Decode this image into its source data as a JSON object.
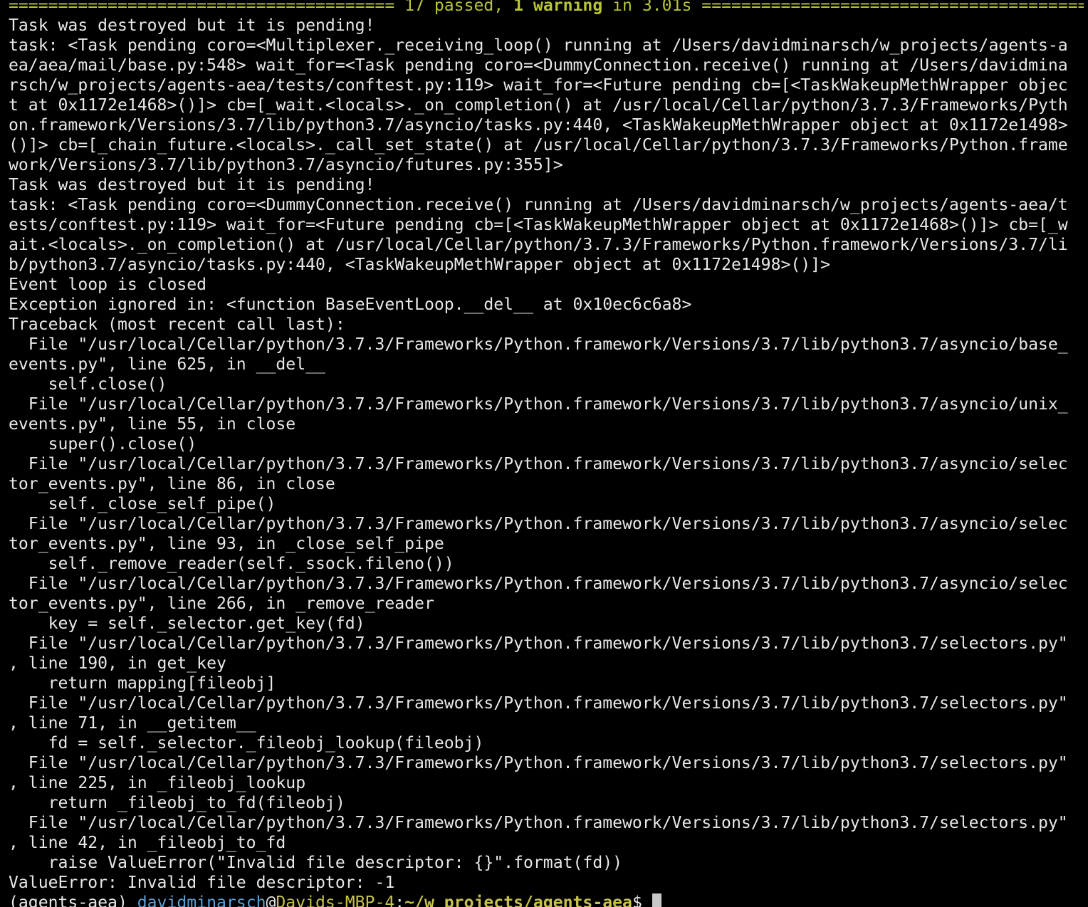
{
  "summary": {
    "left_rule": "======================================= ",
    "passed": "17 passed",
    "comma": ", ",
    "warning": "1 warning",
    "timing": " in 3.01s ",
    "right_rule": "========================================"
  },
  "output_lines": [
    "Task was destroyed but it is pending!",
    "task: <Task pending coro=<Multiplexer._receiving_loop() running at /Users/davidminarsch/w_projects/agents-a",
    "ea/aea/mail/base.py:548> wait_for=<Task pending coro=<DummyConnection.receive() running at /Users/davidmina",
    "rsch/w_projects/agents-aea/tests/conftest.py:119> wait_for=<Future pending cb=[<TaskWakeupMethWrapper objec",
    "t at 0x1172e1468>()]> cb=[_wait.<locals>._on_completion() at /usr/local/Cellar/python/3.7.3/Frameworks/Pyth",
    "on.framework/Versions/3.7/lib/python3.7/asyncio/tasks.py:440, <TaskWakeupMethWrapper object at 0x1172e1498>",
    "()]> cb=[_chain_future.<locals>._call_set_state() at /usr/local/Cellar/python/3.7.3/Frameworks/Python.frame",
    "work/Versions/3.7/lib/python3.7/asyncio/futures.py:355]>",
    "Task was destroyed but it is pending!",
    "task: <Task pending coro=<DummyConnection.receive() running at /Users/davidminarsch/w_projects/agents-aea/t",
    "ests/conftest.py:119> wait_for=<Future pending cb=[<TaskWakeupMethWrapper object at 0x1172e1468>()]> cb=[_w",
    "ait.<locals>._on_completion() at /usr/local/Cellar/python/3.7.3/Frameworks/Python.framework/Versions/3.7/li",
    "b/python3.7/asyncio/tasks.py:440, <TaskWakeupMethWrapper object at 0x1172e1498>()]>",
    "Event loop is closed",
    "Exception ignored in: <function BaseEventLoop.__del__ at 0x10ec6c6a8>",
    "Traceback (most recent call last):",
    "  File \"/usr/local/Cellar/python/3.7.3/Frameworks/Python.framework/Versions/3.7/lib/python3.7/asyncio/base_",
    "events.py\", line 625, in __del__",
    "    self.close()",
    "  File \"/usr/local/Cellar/python/3.7.3/Frameworks/Python.framework/Versions/3.7/lib/python3.7/asyncio/unix_",
    "events.py\", line 55, in close",
    "    super().close()",
    "  File \"/usr/local/Cellar/python/3.7.3/Frameworks/Python.framework/Versions/3.7/lib/python3.7/asyncio/selec",
    "tor_events.py\", line 86, in close",
    "    self._close_self_pipe()",
    "  File \"/usr/local/Cellar/python/3.7.3/Frameworks/Python.framework/Versions/3.7/lib/python3.7/asyncio/selec",
    "tor_events.py\", line 93, in _close_self_pipe",
    "    self._remove_reader(self._ssock.fileno())",
    "  File \"/usr/local/Cellar/python/3.7.3/Frameworks/Python.framework/Versions/3.7/lib/python3.7/asyncio/selec",
    "tor_events.py\", line 266, in _remove_reader",
    "    key = self._selector.get_key(fd)",
    "  File \"/usr/local/Cellar/python/3.7.3/Frameworks/Python.framework/Versions/3.7/lib/python3.7/selectors.py\"",
    ", line 190, in get_key",
    "    return mapping[fileobj]",
    "  File \"/usr/local/Cellar/python/3.7.3/Frameworks/Python.framework/Versions/3.7/lib/python3.7/selectors.py\"",
    ", line 71, in __getitem__",
    "    fd = self._selector._fileobj_lookup(fileobj)",
    "  File \"/usr/local/Cellar/python/3.7.3/Frameworks/Python.framework/Versions/3.7/lib/python3.7/selectors.py\"",
    ", line 225, in _fileobj_lookup",
    "    return _fileobj_to_fd(fileobj)",
    "  File \"/usr/local/Cellar/python/3.7.3/Frameworks/Python.framework/Versions/3.7/lib/python3.7/selectors.py\"",
    ", line 42, in _fileobj_to_fd",
    "    raise ValueError(\"Invalid file descriptor: {}\".format(fd))",
    "ValueError: Invalid file descriptor: -1"
  ],
  "prompt": {
    "env": "(agents-aea) ",
    "user": "davidminarsch",
    "at": "@",
    "host": "Davids-MBP-4",
    "colon": ":",
    "path": "~/w_projects/agents-aea",
    "symbol": "$ "
  },
  "colors": {
    "background": "#000000",
    "text": "#e8e8e8",
    "summary": "#b9c435",
    "prompt_user": "#5aa1d6",
    "prompt_host": "#c7c24a"
  }
}
